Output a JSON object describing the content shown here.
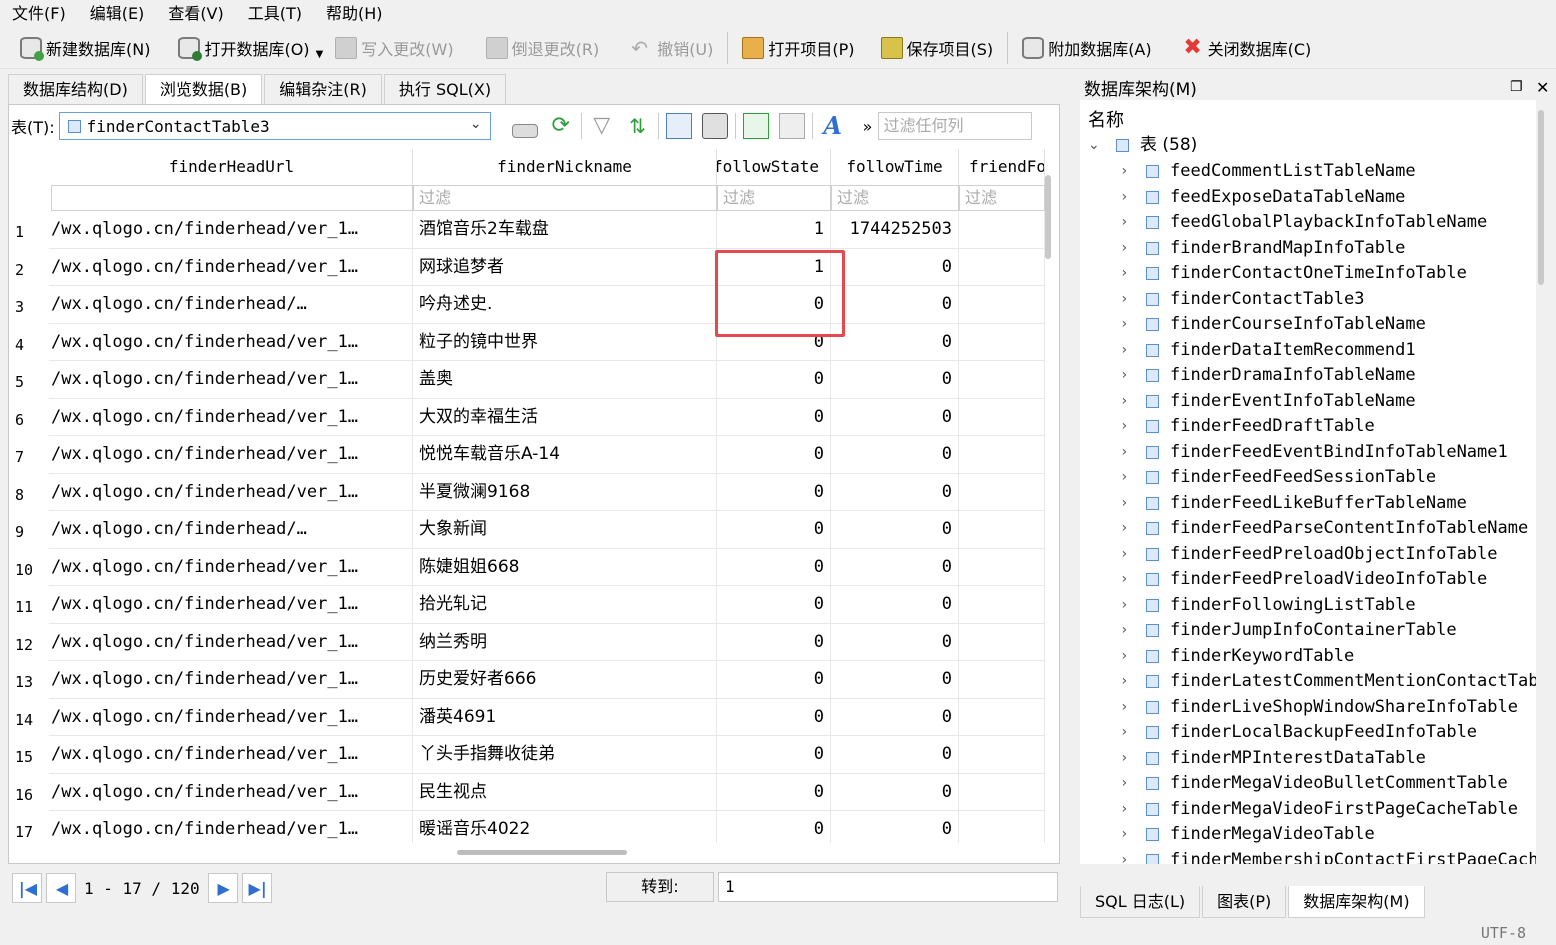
{
  "menu": [
    "文件(F)",
    "编辑(E)",
    "查看(V)",
    "工具(T)",
    "帮助(H)"
  ],
  "toolbar": {
    "new_db": "新建数据库(N)",
    "open_db": "打开数据库(O)",
    "write_changes": "写入更改(W)",
    "revert_changes": "倒退更改(R)",
    "undo": "撤销(U)",
    "open_project": "打开项目(P)",
    "save_project": "保存项目(S)",
    "attach_db": "附加数据库(A)",
    "close_db": "关闭数据库(C)"
  },
  "tabs": [
    "数据库结构(D)",
    "浏览数据(B)",
    "编辑杂注(R)",
    "执行 SQL(X)"
  ],
  "browse": {
    "table_label": "表(T):",
    "table_name": "finderContactTable3",
    "filter_any": "过滤任何列",
    "overflow": "»"
  },
  "grid": {
    "columns": [
      "finderHeadUrl",
      "finderNickname",
      "followState",
      "followTime",
      "friendFollow"
    ],
    "filter_placeholder": "过滤",
    "rows": [
      {
        "n": "1",
        "url": "/wx.qlogo.cn/finderhead/ver_1…",
        "nick": "酒馆音乐2车载盘",
        "state": "1",
        "time": "1744252503"
      },
      {
        "n": "2",
        "url": "/wx.qlogo.cn/finderhead/ver_1…",
        "nick": "网球追梦者",
        "state": "1",
        "time": "0"
      },
      {
        "n": "3",
        "url": "/wx.qlogo.cn/finderhead/…",
        "nick": "吟舟述史.",
        "state": "0",
        "time": "0"
      },
      {
        "n": "4",
        "url": "/wx.qlogo.cn/finderhead/ver_1…",
        "nick": "粒子的镜中世界",
        "state": "0",
        "time": "0"
      },
      {
        "n": "5",
        "url": "/wx.qlogo.cn/finderhead/ver_1…",
        "nick": "盖奥",
        "state": "0",
        "time": "0"
      },
      {
        "n": "6",
        "url": "/wx.qlogo.cn/finderhead/ver_1…",
        "nick": "大双的幸福生活",
        "state": "0",
        "time": "0"
      },
      {
        "n": "7",
        "url": "/wx.qlogo.cn/finderhead/ver_1…",
        "nick": "悦悦车载音乐A-14",
        "state": "0",
        "time": "0"
      },
      {
        "n": "8",
        "url": "/wx.qlogo.cn/finderhead/ver_1…",
        "nick": "半夏微澜9168",
        "state": "0",
        "time": "0"
      },
      {
        "n": "9",
        "url": "/wx.qlogo.cn/finderhead/…",
        "nick": "大象新闻",
        "state": "0",
        "time": "0"
      },
      {
        "n": "10",
        "url": "/wx.qlogo.cn/finderhead/ver_1…",
        "nick": "陈婕姐姐668",
        "state": "0",
        "time": "0"
      },
      {
        "n": "11",
        "url": "/wx.qlogo.cn/finderhead/ver_1…",
        "nick": "拾光轧记",
        "state": "0",
        "time": "0"
      },
      {
        "n": "12",
        "url": "/wx.qlogo.cn/finderhead/ver_1…",
        "nick": "纳兰秀明",
        "state": "0",
        "time": "0"
      },
      {
        "n": "13",
        "url": "/wx.qlogo.cn/finderhead/ver_1…",
        "nick": "历史爱好者666",
        "state": "0",
        "time": "0"
      },
      {
        "n": "14",
        "url": "/wx.qlogo.cn/finderhead/ver_1…",
        "nick": "潘英4691",
        "state": "0",
        "time": "0"
      },
      {
        "n": "15",
        "url": "/wx.qlogo.cn/finderhead/ver_1…",
        "nick": "丫头手指舞收徒弟",
        "state": "0",
        "time": "0"
      },
      {
        "n": "16",
        "url": "/wx.qlogo.cn/finderhead/ver_1…",
        "nick": "民生视点",
        "state": "0",
        "time": "0"
      },
      {
        "n": "17",
        "url": "/wx.qlogo.cn/finderhead/ver_1…",
        "nick": "暖谣音乐4022",
        "state": "0",
        "time": "0"
      }
    ]
  },
  "nav": {
    "page_range": "1 - 17 / 120",
    "goto_label": "转到:",
    "goto_value": "1"
  },
  "schema": {
    "panel_title": "数据库架构(M)",
    "name_header": "名称",
    "tables_label": "表 (58)",
    "tables": [
      "feedCommentListTableName",
      "feedExposeDataTableName",
      "feedGlobalPlaybackInfoTableName",
      "finderBrandMapInfoTable",
      "finderContactOneTimeInfoTable",
      "finderContactTable3",
      "finderCourseInfoTableName",
      "finderDataItemRecommend1",
      "finderDramaInfoTableName",
      "finderEventInfoTableName",
      "finderFeedDraftTable",
      "finderFeedEventBindInfoTableName1",
      "finderFeedFeedSessionTable",
      "finderFeedLikeBufferTableName",
      "finderFeedParseContentInfoTableName",
      "finderFeedPreloadObjectInfoTable",
      "finderFeedPreloadVideoInfoTable",
      "finderFollowingListTable",
      "finderJumpInfoContainerTable",
      "finderKeywordTable",
      "finderLatestCommentMentionContactTable",
      "finderLiveShopWindowShareInfoTable",
      "finderLocalBackupFeedInfoTable",
      "finderMPInterestDataTable",
      "finderMegaVideoBulletCommentTable",
      "finderMegaVideoFirstPageCacheTable",
      "finderMegaVideoTable",
      "finderMembershipContactFirstPageCache"
    ]
  },
  "bottom_tabs": [
    "SQL 日志(L)",
    "图表(P)",
    "数据库架构(M)"
  ],
  "status": {
    "encoding": "UTF-8"
  }
}
